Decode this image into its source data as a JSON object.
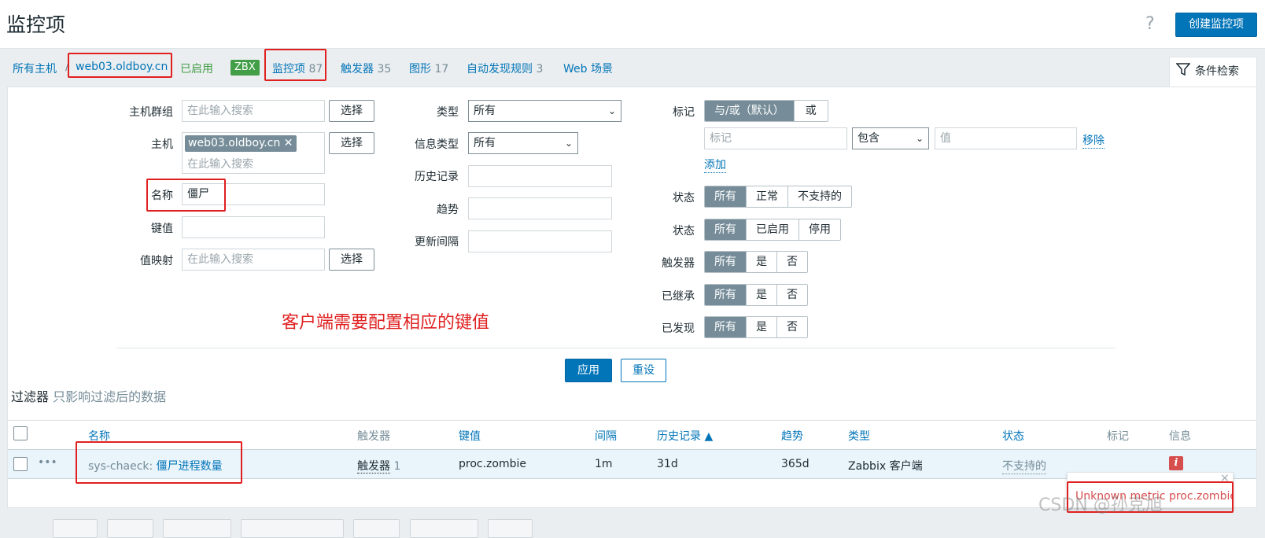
{
  "header": {
    "title": "监控项",
    "help_icon": "?",
    "create_button": "创建监控项"
  },
  "nav": {
    "all_hosts": "所有主机",
    "sep": "/",
    "host": "web03.oldboy.cn",
    "enabled": "已启用",
    "zbx": "ZBX",
    "items_label": "监控项",
    "items_count": "87",
    "triggers_label": "触发器",
    "triggers_count": "35",
    "graphs_label": "图形",
    "graphs_count": "17",
    "discovery_label": "自动发现规则",
    "discovery_count": "3",
    "web_label": "Web 场景"
  },
  "filter_tab": {
    "label": "条件检索"
  },
  "filter": {
    "host_groups": {
      "label": "主机群组",
      "placeholder": "在此输入搜索",
      "select": "选择"
    },
    "hosts": {
      "label": "主机",
      "chip": "web03.oldboy.cn",
      "chip_remove": "✕",
      "placeholder": "在此输入搜索",
      "select": "选择"
    },
    "name": {
      "label": "名称",
      "value": "僵尸"
    },
    "key": {
      "label": "键值",
      "value": ""
    },
    "value_map": {
      "label": "值映射",
      "placeholder": "在此输入搜索",
      "select": "选择"
    },
    "type": {
      "label": "类型",
      "value": "所有"
    },
    "info_type": {
      "label": "信息类型",
      "value": "所有"
    },
    "history": {
      "label": "历史记录",
      "value": ""
    },
    "trends": {
      "label": "趋势",
      "value": ""
    },
    "update_interval": {
      "label": "更新间隔",
      "value": ""
    },
    "tags": {
      "label": "标记",
      "operator": [
        "与/或（默认）",
        "或"
      ],
      "tag_placeholder": "标记",
      "condition": "包含",
      "value_placeholder": "值",
      "remove": "移除",
      "add": "添加"
    },
    "state": {
      "label": "状态",
      "options": [
        "所有",
        "正常",
        "不支持的"
      ]
    },
    "status": {
      "label": "状态",
      "options": [
        "所有",
        "已启用",
        "停用"
      ]
    },
    "triggers": {
      "label": "触发器",
      "options": [
        "所有",
        "是",
        "否"
      ]
    },
    "inherited": {
      "label": "已继承",
      "options": [
        "所有",
        "是",
        "否"
      ]
    },
    "discovered": {
      "label": "已发现",
      "options": [
        "所有",
        "是",
        "否"
      ]
    },
    "apply": "应用",
    "reset": "重设"
  },
  "annotation": "客户端需要配置相应的键值",
  "filter_note": {
    "title": "过滤器",
    "text": "只影响过滤后的数据"
  },
  "table": {
    "columns": {
      "name": "名称",
      "triggers": "触发器",
      "key": "键值",
      "interval": "间隔",
      "history": "历史记录 ▲",
      "trends": "趋势",
      "type": "类型",
      "status": "状态",
      "tags": "标记",
      "info": "信息"
    },
    "row": {
      "menu": "•••",
      "template": "sys-chaeck:",
      "name": "僵尸进程数量",
      "triggers_label": "触发器",
      "triggers_count": "1",
      "key": "proc.zombie",
      "interval": "1m",
      "history": "31d",
      "trends": "365d",
      "type": "Zabbix 客户端",
      "status": "不支持的",
      "info": "i"
    }
  },
  "tooltip": {
    "text": "Unknown metric proc.zombie",
    "close": "×"
  },
  "watermark": "CSDN @孙克旭"
}
